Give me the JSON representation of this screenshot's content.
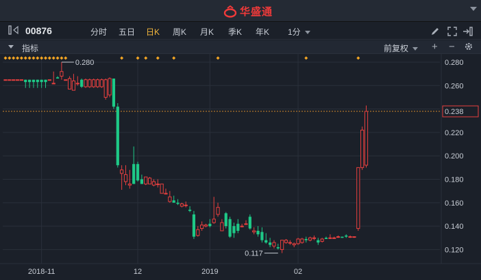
{
  "app": {
    "name": "华盛通"
  },
  "toolbar": {
    "code": "00876",
    "periods": [
      "分时",
      "五日",
      "日K",
      "周K",
      "月K",
      "季K",
      "年K"
    ],
    "active_period": "日K",
    "minute": "1分"
  },
  "indicator_bar": {
    "label": "指标",
    "adjust": "前复权",
    "plus": "+",
    "minus": "−"
  },
  "colors": {
    "up": "#e8403f",
    "down": "#1ec987",
    "marker": "#f5a623",
    "current_line": "#d48a2a",
    "grid": "#2a303b"
  },
  "chart_data": {
    "type": "candlestick",
    "ylim": [
      0.108,
      0.287
    ],
    "y_ticks": [
      "0.280",
      "0.260",
      "0.240",
      "0.220",
      "0.200",
      "0.180",
      "0.160",
      "0.140",
      "0.120"
    ],
    "x_ticks": [
      {
        "label": "2018-11",
        "index": 9
      },
      {
        "label": "12",
        "index": 33
      },
      {
        "label": "2019",
        "index": 51
      },
      {
        "label": "02",
        "index": 73
      }
    ],
    "current_price": "0.238",
    "high_annotation": {
      "label": "0.280",
      "index": 14,
      "value": 0.28
    },
    "low_annotation": {
      "label": "0.117",
      "index": 68,
      "value": 0.117
    },
    "marker_indices": [
      0,
      1,
      2,
      3,
      4,
      5,
      6,
      7,
      8,
      9,
      10,
      11,
      12,
      13,
      14,
      15,
      29,
      33,
      35,
      38,
      42,
      53,
      75,
      88
    ],
    "candles": [
      [
        0.265,
        0.265,
        0.265,
        0.265
      ],
      [
        0.265,
        0.265,
        0.265,
        0.265
      ],
      [
        0.265,
        0.265,
        0.265,
        0.265
      ],
      [
        0.265,
        0.265,
        0.265,
        0.265
      ],
      [
        0.265,
        0.265,
        0.265,
        0.265
      ],
      [
        0.265,
        0.265,
        0.263,
        0.258
      ],
      [
        0.265,
        0.265,
        0.263,
        0.258
      ],
      [
        0.265,
        0.265,
        0.263,
        0.258
      ],
      [
        0.265,
        0.265,
        0.263,
        0.258
      ],
      [
        0.265,
        0.265,
        0.263,
        0.258
      ],
      [
        0.265,
        0.265,
        0.263,
        0.258
      ],
      [
        0.265,
        0.265,
        0.265,
        0.265
      ],
      [
        0.262,
        0.272,
        0.262,
        0.262
      ],
      [
        0.267,
        0.268,
        0.266,
        0.266
      ],
      [
        0.268,
        0.28,
        0.272,
        0.265
      ],
      [
        0.265,
        0.265,
        0.265,
        0.265
      ],
      [
        0.257,
        0.268,
        0.266,
        0.262
      ],
      [
        0.256,
        0.27,
        0.264,
        0.256
      ],
      [
        0.262,
        0.268,
        0.262,
        0.26
      ],
      [
        0.265,
        0.266,
        0.259,
        0.258
      ],
      [
        0.259,
        0.266,
        0.265,
        0.258
      ],
      [
        0.259,
        0.266,
        0.265,
        0.258
      ],
      [
        0.259,
        0.266,
        0.265,
        0.258
      ],
      [
        0.259,
        0.266,
        0.265,
        0.258
      ],
      [
        0.259,
        0.266,
        0.265,
        0.258
      ],
      [
        0.25,
        0.266,
        0.265,
        0.248
      ],
      [
        0.252,
        0.267,
        0.266,
        0.25
      ],
      [
        0.266,
        0.266,
        0.242,
        0.24
      ],
      [
        0.242,
        0.245,
        0.192,
        0.19
      ],
      [
        0.185,
        0.192,
        0.188,
        0.171
      ],
      [
        0.178,
        0.192,
        0.184,
        0.175
      ],
      [
        0.175,
        0.188,
        0.176,
        0.172
      ],
      [
        0.193,
        0.208,
        0.176,
        0.178
      ],
      [
        0.193,
        0.195,
        0.179,
        0.178
      ],
      [
        0.18,
        0.184,
        0.176,
        0.176
      ],
      [
        0.176,
        0.181,
        0.182,
        0.175
      ],
      [
        0.176,
        0.182,
        0.181,
        0.176
      ],
      [
        0.175,
        0.18,
        0.178,
        0.174
      ],
      [
        0.176,
        0.18,
        0.176,
        0.173
      ],
      [
        0.168,
        0.176,
        0.176,
        0.168
      ],
      [
        0.168,
        0.172,
        0.168,
        0.167
      ],
      [
        0.161,
        0.17,
        0.165,
        0.16
      ],
      [
        0.162,
        0.166,
        0.16,
        0.16
      ],
      [
        0.16,
        0.163,
        0.159,
        0.158
      ],
      [
        0.157,
        0.16,
        0.159,
        0.156
      ],
      [
        0.158,
        0.161,
        0.158,
        0.156
      ],
      [
        0.154,
        0.157,
        0.153,
        0.152
      ],
      [
        0.15,
        0.153,
        0.131,
        0.129
      ],
      [
        0.132,
        0.14,
        0.137,
        0.131
      ],
      [
        0.138,
        0.144,
        0.141,
        0.136
      ],
      [
        0.14,
        0.142,
        0.141,
        0.139
      ],
      [
        0.142,
        0.146,
        0.14,
        0.139
      ],
      [
        0.143,
        0.165,
        0.146,
        0.142
      ],
      [
        0.15,
        0.16,
        0.156,
        0.148
      ],
      [
        0.136,
        0.146,
        0.143,
        0.136
      ],
      [
        0.151,
        0.152,
        0.14,
        0.138
      ],
      [
        0.146,
        0.148,
        0.131,
        0.13
      ],
      [
        0.14,
        0.143,
        0.134,
        0.13
      ],
      [
        0.142,
        0.146,
        0.136,
        0.134
      ],
      [
        0.14,
        0.142,
        0.14,
        0.139
      ],
      [
        0.142,
        0.145,
        0.142,
        0.141
      ],
      [
        0.148,
        0.15,
        0.138,
        0.137
      ],
      [
        0.135,
        0.139,
        0.136,
        0.133
      ],
      [
        0.136,
        0.14,
        0.133,
        0.131
      ],
      [
        0.135,
        0.139,
        0.128,
        0.126
      ],
      [
        0.128,
        0.134,
        0.126,
        0.125
      ],
      [
        0.126,
        0.13,
        0.124,
        0.122
      ],
      [
        0.123,
        0.128,
        0.126,
        0.121
      ],
      [
        0.122,
        0.125,
        0.121,
        0.12
      ],
      [
        0.12,
        0.128,
        0.128,
        0.117
      ],
      [
        0.126,
        0.129,
        0.128,
        0.125
      ],
      [
        0.126,
        0.128,
        0.126,
        0.124
      ],
      [
        0.124,
        0.126,
        0.125,
        0.122
      ],
      [
        0.125,
        0.13,
        0.129,
        0.124
      ],
      [
        0.126,
        0.13,
        0.129,
        0.125
      ],
      [
        0.129,
        0.131,
        0.128,
        0.126
      ],
      [
        0.128,
        0.131,
        0.13,
        0.127
      ],
      [
        0.13,
        0.132,
        0.13,
        0.128
      ],
      [
        0.128,
        0.13,
        0.126,
        0.124
      ],
      [
        0.127,
        0.13,
        0.129,
        0.126
      ],
      [
        0.13,
        0.131,
        0.129,
        0.129
      ],
      [
        0.13,
        0.133,
        0.13,
        0.129
      ],
      [
        0.13,
        0.131,
        0.13,
        0.129
      ],
      [
        0.131,
        0.132,
        0.131,
        0.13
      ],
      [
        0.131,
        0.131,
        0.13,
        0.13
      ],
      [
        0.132,
        0.133,
        0.131,
        0.13
      ],
      [
        0.131,
        0.132,
        0.131,
        0.13
      ],
      [
        0.131,
        0.131,
        0.131,
        0.13
      ],
      [
        0.138,
        0.15,
        0.19,
        0.136
      ],
      [
        0.19,
        0.225,
        0.222,
        0.188
      ],
      [
        0.192,
        0.243,
        0.238,
        0.19
      ]
    ]
  }
}
